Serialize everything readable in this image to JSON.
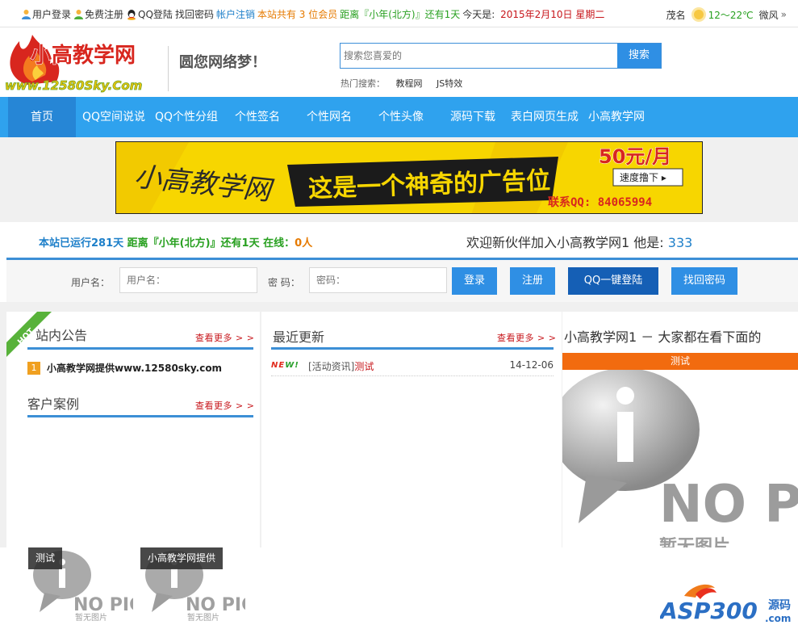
{
  "topbar": {
    "login": "用户登录",
    "register": "免费注册",
    "qq_login": "QQ登陆",
    "find_pwd": "找回密码",
    "logout": "帐户注销",
    "members": "本站共有 3 位会员",
    "countdown": "距离『小年(北方)』还有1天",
    "today": "今天是: 2015年2月10日 星期二",
    "city": "茂名",
    "temp": "12～22℃",
    "wind": "微风",
    "arrow": "»"
  },
  "header": {
    "logo_text": "小高教学网",
    "logo_url": "www.12580Sky.Com",
    "slogan": "圆您网络梦！",
    "search_placeholder": "搜索您喜爱的",
    "search_button": "搜索",
    "hot_label": "热门搜索：",
    "hot_keywords": [
      "教程网",
      "JS特效"
    ]
  },
  "nav": {
    "items": [
      "首页",
      "QQ空间说说",
      "QQ个性分组",
      "个性签名",
      "个性网名",
      "个性头像",
      "源码下载",
      "表白网页生成",
      "小高教学网"
    ]
  },
  "banner": {
    "brand": "小高教学网",
    "headline": "这是一个神奇的广告位",
    "price": "50元/月",
    "cta": "速度撸下 ▸",
    "contact": "联系QQ: 84065994"
  },
  "stats": {
    "running": "本站已运行281天",
    "countdown": "距离『小年(北方)』还有1天",
    "online_label": "在线：",
    "online": "0人",
    "welcome": "欢迎新伙伴加入小高教学网1 他是:",
    "new_member": "333"
  },
  "login": {
    "user_label": "用户名：",
    "user_placeholder": "用户名：",
    "pwd_label": "密 码：",
    "pwd_placeholder": "密码：",
    "login_button": "登录",
    "register_button": "注册",
    "qq_button": "QQ一键登陆",
    "find_button": "找回密码"
  },
  "left": {
    "hot_tag": "HOT",
    "notice_title": "站内公告",
    "notice_more": "查看更多 > >",
    "notice_items": [
      {
        "num": "1",
        "text": "小高教学网提供www.12580sky.com"
      }
    ],
    "case_title": "客户案例",
    "case_more": "查看更多 > >"
  },
  "middle": {
    "title": "最近更新",
    "more": "查看更多 > >",
    "items": [
      {
        "tag_a": "NE",
        "tag_b": "W!",
        "category": "[活动资讯]",
        "title": "测试",
        "date": "14-12-06"
      }
    ]
  },
  "right": {
    "title": "小高教学网1 － 大家都在看下面的",
    "bar": "测试",
    "nopic": "NO PIC",
    "nopic_sub": "暂无图片"
  },
  "bottom": {
    "thumbs": [
      {
        "label": "测试"
      },
      {
        "label": "小高教学网提供"
      }
    ],
    "nopic": "NO PIC",
    "nopic_sub": "暂无图片",
    "wm_brand": "ASP300",
    "wm_cn": "源码",
    "wm_com": ".com"
  }
}
